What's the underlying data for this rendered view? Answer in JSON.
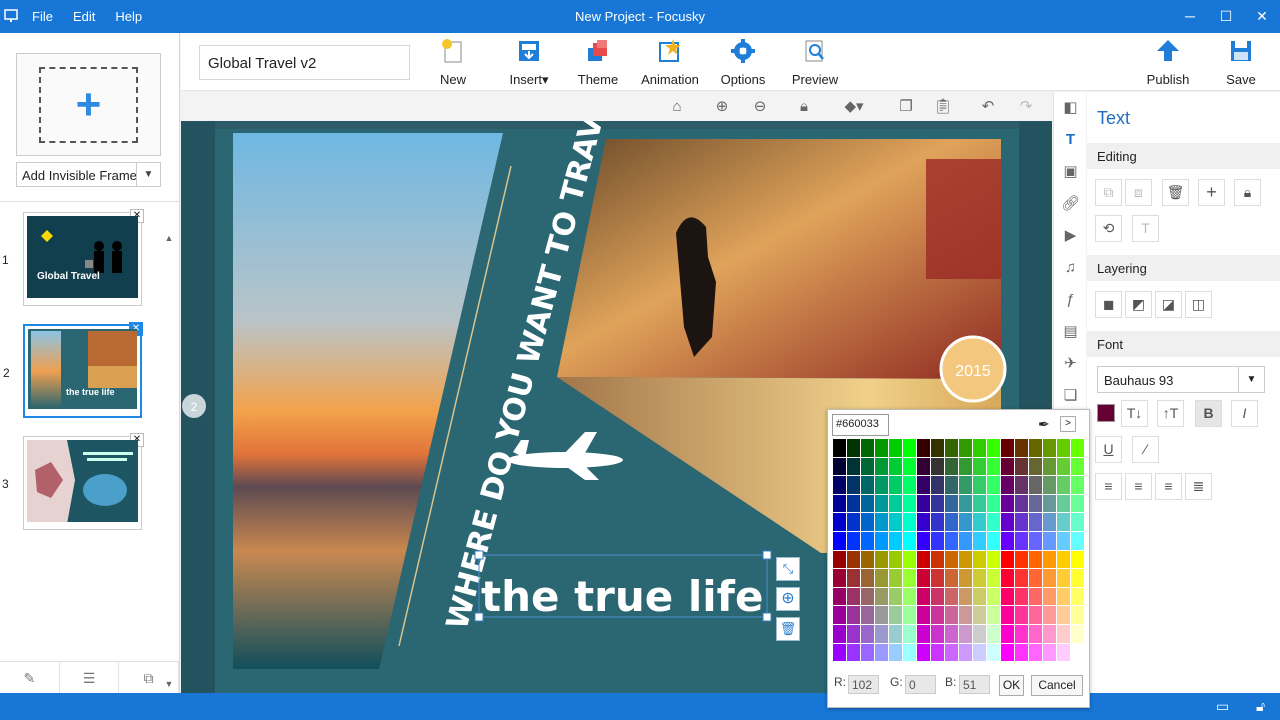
{
  "window": {
    "title": "New Project - Focusky",
    "menu": [
      "File",
      "Edit",
      "Help"
    ],
    "controls": [
      "─",
      "☐",
      "✕"
    ]
  },
  "toolbar": {
    "project_name": "Global Travel v2",
    "buttons": [
      "New",
      "Insert▾",
      "Theme",
      "Animation",
      "Options",
      "Preview"
    ],
    "publish": "Publish",
    "save": "Save"
  },
  "left_panel": {
    "add_frame_type": "Add Invisible Frame",
    "thumbnails": [
      {
        "number": "1",
        "caption": "Global Travel"
      },
      {
        "number": "2",
        "caption": "the true life"
      },
      {
        "number": "3",
        "caption": ""
      }
    ]
  },
  "canvas": {
    "frame_badge": "2",
    "vertical_text": "WHERE DO YOU WANT TO TRAVEL?",
    "year_badge": "2015",
    "selected_text": "the true life"
  },
  "properties": {
    "title": "Text",
    "sections": {
      "editing": "Editing",
      "layering": "Layering",
      "font": "Font"
    },
    "font_name": "Bauhaus 93",
    "bold": "B",
    "italic": "I",
    "underline": "U"
  },
  "color_picker": {
    "hex": "#660033",
    "r_label": "R:",
    "r": "102",
    "g_label": "G:",
    "g": "0",
    "b_label": "B:",
    "b": "51",
    "ok": "OK",
    "cancel": "Cancel",
    "more": ">"
  },
  "icons": {
    "accent": "#1776d6"
  }
}
